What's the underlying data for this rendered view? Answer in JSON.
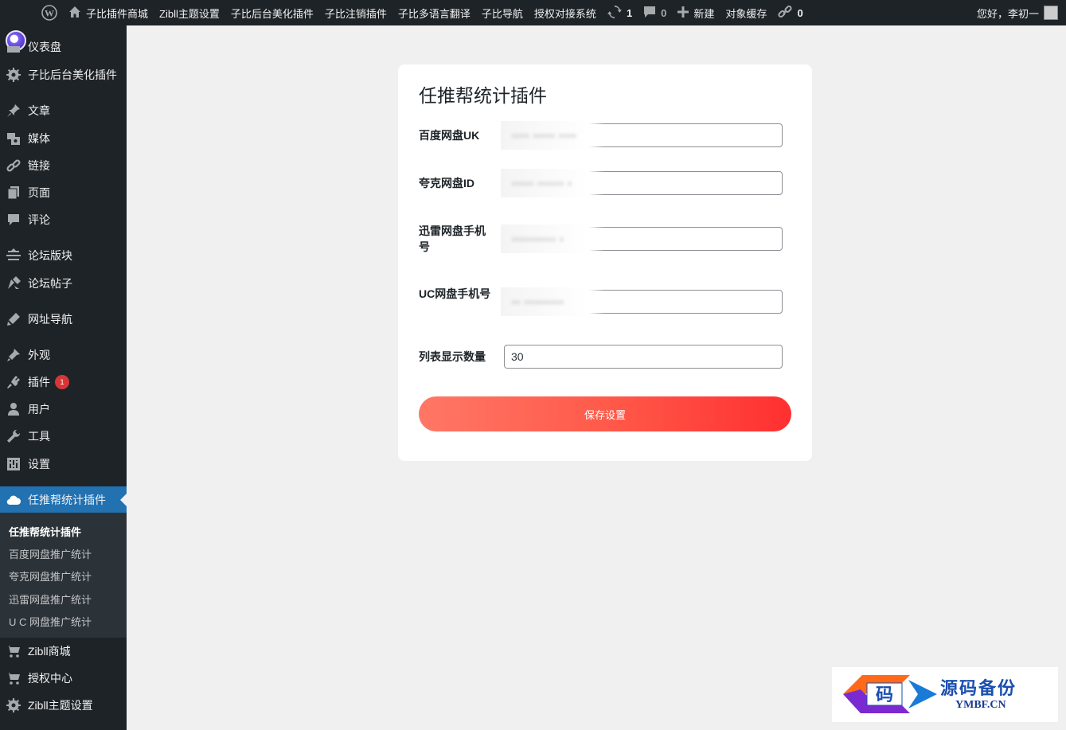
{
  "adminbar": {
    "items": [
      "子比插件商城",
      "Zibll主题设置",
      "子比后台美化插件",
      "子比注销插件",
      "子比多语言翻译",
      "子比导航",
      "授权对接系统"
    ],
    "updates_count": "1",
    "comments_count": "0",
    "new_label": "新建",
    "object_cache_label": "对象缓存",
    "links_count": "0",
    "greeting": "您好，李初一"
  },
  "sidebar": {
    "items": [
      {
        "label": "仪表盘",
        "icon": "dashboard-icon"
      },
      {
        "label": "子比后台美化插件",
        "icon": "gear-icon"
      },
      {
        "label": "文章",
        "icon": "pin-icon"
      },
      {
        "label": "媒体",
        "icon": "media-icon"
      },
      {
        "label": "链接",
        "icon": "link-icon"
      },
      {
        "label": "页面",
        "icon": "page-icon"
      },
      {
        "label": "评论",
        "icon": "comment-icon"
      },
      {
        "label": "论坛版块",
        "icon": "forum-icon"
      },
      {
        "label": "论坛帖子",
        "icon": "post-icon"
      },
      {
        "label": "网址导航",
        "icon": "brush-icon"
      },
      {
        "label": "外观",
        "icon": "appearance-icon"
      },
      {
        "label": "插件",
        "icon": "plugin-icon",
        "badge": "1"
      },
      {
        "label": "用户",
        "icon": "user-icon"
      },
      {
        "label": "工具",
        "icon": "wrench-icon"
      },
      {
        "label": "设置",
        "icon": "settings-icon"
      },
      {
        "label": "任推帮统计插件",
        "icon": "cloud-icon"
      },
      {
        "label": "Zibll商城",
        "icon": "cart-icon"
      },
      {
        "label": "授权中心",
        "icon": "cart-icon"
      },
      {
        "label": "Zibll主题设置",
        "icon": "gear-icon"
      }
    ],
    "submenu": [
      "任推帮统计插件",
      "百度网盘推广统计",
      "夸克网盘推广统计",
      "迅雷网盘推广统计",
      "U C 网盘推广统计"
    ]
  },
  "form": {
    "title": "任推帮统计插件",
    "fields": [
      {
        "label": "百度网盘UK",
        "value": "",
        "masked": "•••• ••••• ••••"
      },
      {
        "label": "夸克网盘ID",
        "value": "",
        "masked": "••••• •••••• •"
      },
      {
        "label": "迅雷网盘手机号",
        "value": "",
        "masked": "•••••••••• •"
      },
      {
        "label": "UC网盘手机号",
        "value": "",
        "masked": "•• •••••••••"
      },
      {
        "label": "列表显示数量",
        "value": "30"
      }
    ],
    "save_label": "保存设置"
  },
  "watermark": {
    "title": "源码备份",
    "subtitle": "YMBF.CN",
    "glyph": "码"
  },
  "colors": {
    "adminbar_bg": "#1d2327",
    "sidebar_current": "#2271b1",
    "button_gradient_start": "#ff7766",
    "button_gradient_end": "#ff3030"
  }
}
